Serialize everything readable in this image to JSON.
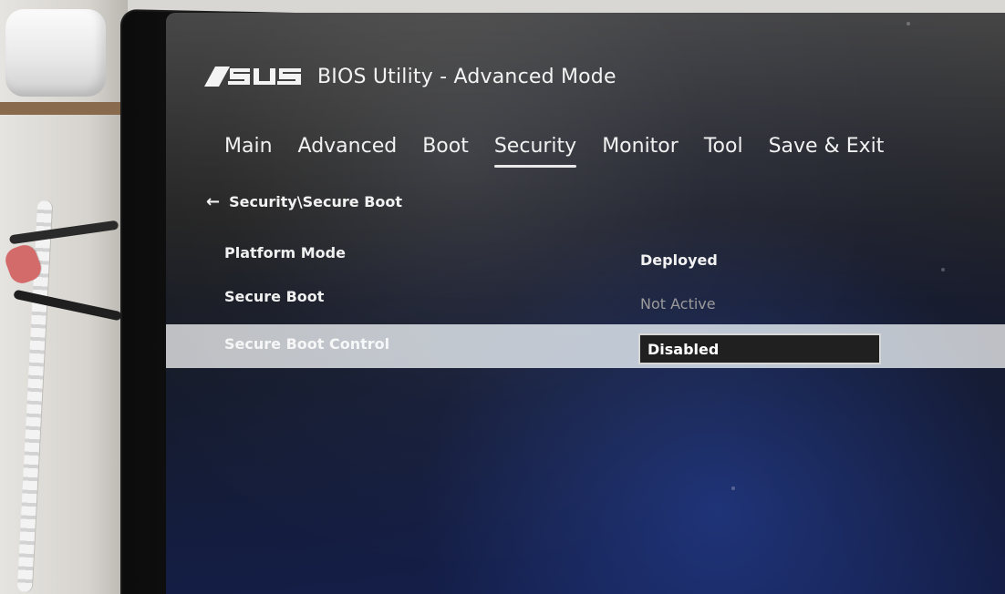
{
  "app": {
    "logo_text": "ASUS",
    "title": "BIOS Utility - Advanced Mode"
  },
  "tabs": [
    {
      "label": "Main",
      "active": false
    },
    {
      "label": "Advanced",
      "active": false
    },
    {
      "label": "Boot",
      "active": false
    },
    {
      "label": "Security",
      "active": true
    },
    {
      "label": "Monitor",
      "active": false
    },
    {
      "label": "Tool",
      "active": false
    },
    {
      "label": "Save & Exit",
      "active": false
    }
  ],
  "breadcrumb": {
    "back_icon": "back-arrow-icon",
    "path": "Security\\Secure Boot"
  },
  "settings": [
    {
      "label": "Platform Mode",
      "value": "Deployed",
      "state": "normal"
    },
    {
      "label": "Secure Boot",
      "value": "Not Active",
      "state": "muted"
    },
    {
      "label": "Secure Boot Control",
      "value": "Disabled",
      "state": "selected"
    }
  ],
  "colors": {
    "selection_bar": "#eaf2f7",
    "muted_text": "#9b9b9b",
    "active_tab_underline": "#e8e8e8"
  }
}
